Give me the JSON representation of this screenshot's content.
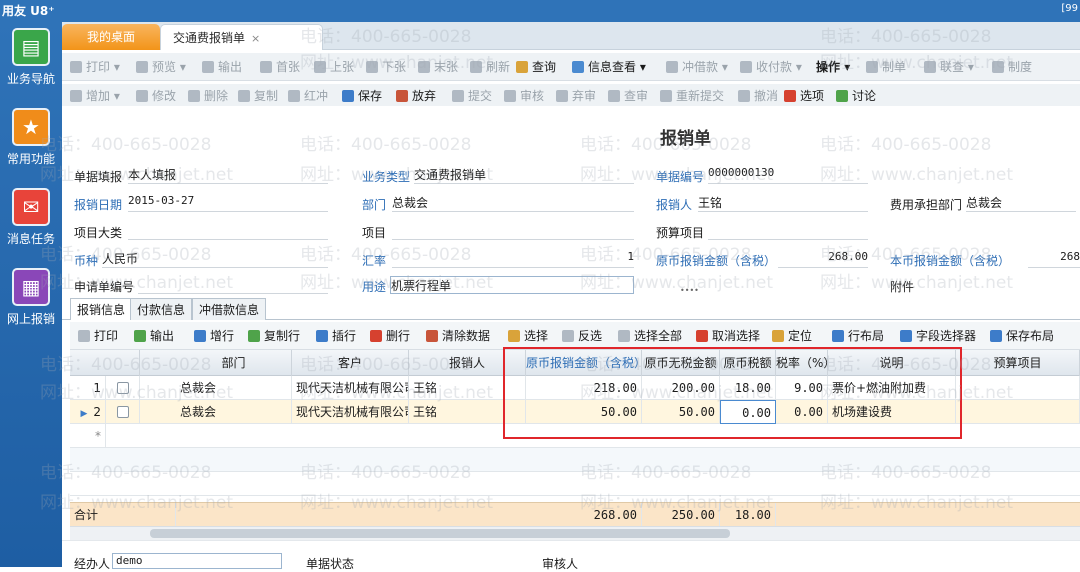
{
  "app": {
    "logo": "用友 U8⁺",
    "topright": "[99"
  },
  "sidebar": [
    {
      "label": "业务导航",
      "icon": "tree-icon"
    },
    {
      "label": "常用功能",
      "icon": "star-icon"
    },
    {
      "label": "消息任务",
      "icon": "mail-icon"
    },
    {
      "label": "网上报销",
      "icon": "document-icon"
    }
  ],
  "tabs": {
    "desk": "我的桌面",
    "current": "交通费报销单",
    "close": "×"
  },
  "toolbar1": [
    "打印",
    "预览",
    "输出",
    "首张",
    "上张",
    "下张",
    "末张",
    "刷新",
    "查询",
    "信息查看",
    "冲借款",
    "收付款",
    "操作",
    "制单",
    "联查",
    "制度"
  ],
  "toolbar2": [
    "增加",
    "修改",
    "删除",
    "复制",
    "红冲",
    "保存",
    "放弃",
    "提交",
    "审核",
    "弃审",
    "查审",
    "重新提交",
    "撤消",
    "选项",
    "讨论"
  ],
  "form": {
    "title": "报销单",
    "row1": {
      "l1": "单据填报",
      "v1": "本人填报",
      "l2": "业务类型",
      "v2": "交通费报销单",
      "l3": "单据编号",
      "v3": "0000000130"
    },
    "row2": {
      "l1": "报销日期",
      "v1": "2015-03-27",
      "l2": "部门",
      "v2": "总裁会",
      "l3": "报销人",
      "v3": "王铭",
      "l4": "费用承担部门",
      "v4": "总裁会"
    },
    "row3": {
      "l1": "项目大类",
      "l2": "项目",
      "l3": "预算项目"
    },
    "row4": {
      "l1": "币种",
      "v1": "人民币",
      "l2": "汇率",
      "v2": "1",
      "l3": "原币报销金额（含税）",
      "v3": "268.00",
      "l4": "本币报销金额（含税）",
      "v4": "268"
    },
    "row5": {
      "l1": "申请单编号",
      "l2": "用途",
      "v2": "机票行程单",
      "l4": "附件",
      "dots": "••••"
    }
  },
  "subtabs": [
    "报销信息",
    "付款信息",
    "冲借款信息"
  ],
  "gridtoolbar": [
    "打印",
    "输出",
    "增行",
    "复制行",
    "插行",
    "删行",
    "清除数据",
    "选择",
    "反选",
    "选择全部",
    "取消选择",
    "定位",
    "行布局",
    "字段选择器",
    "保存布局"
  ],
  "grid": {
    "columns": [
      "部门",
      "客户",
      "报销人",
      "原币报销金额（含税）",
      "原币无税金额",
      "原币税额",
      "税率（%）",
      "说明",
      "预算项目"
    ],
    "rows": [
      {
        "no": "1",
        "dept": "总裁会",
        "customer": "现代天洁机械有限公司",
        "person": "王铭",
        "amount": "218.00",
        "notax": "200.00",
        "tax": "18.00",
        "rate": "9.00",
        "desc": "票价+燃油附加费"
      },
      {
        "no": "2",
        "dept": "总裁会",
        "customer": "现代天洁机械有限公司",
        "person": "王铭",
        "amount": "50.00",
        "notax": "50.00",
        "tax": "0.00",
        "rate": "0.00",
        "desc": "机场建设费"
      }
    ],
    "newrow": "*",
    "total": {
      "label": "合计",
      "amount": "268.00",
      "notax": "250.00",
      "tax": "18.00"
    }
  },
  "bottom": {
    "handler_label": "经办人",
    "handler": "demo",
    "status_label": "单据状态",
    "reviewer_label": "审核人"
  },
  "watermark": {
    "phone": "电话：400-665-0028",
    "site": "网址：www.chanjet.net"
  }
}
